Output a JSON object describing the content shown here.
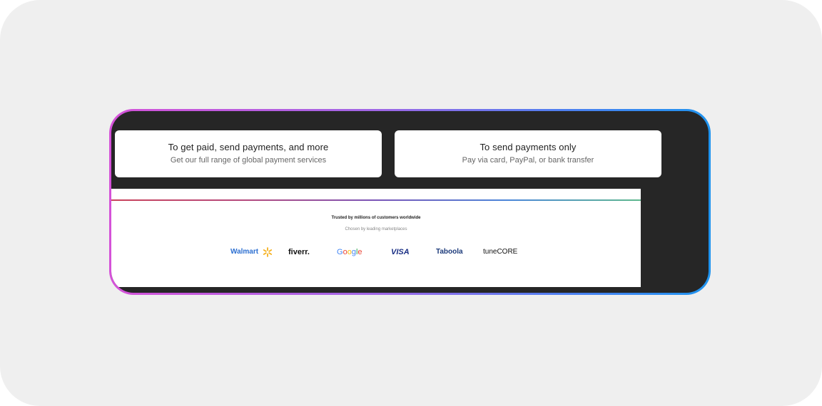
{
  "cards": [
    {
      "title": "To get paid, send payments, and more",
      "subtitle": "Get our full range of global payment services"
    },
    {
      "title": "To send payments only",
      "subtitle": "Pay via card, PayPal, or bank transfer"
    }
  ],
  "trust": {
    "heading": "Trusted by millions of customers worldwide",
    "subheading": "Chosen by leading marketplaces"
  },
  "logos": {
    "walmart": "Walmart",
    "fiverr": "fiverr.",
    "google": [
      "G",
      "o",
      "o",
      "g",
      "l",
      "e"
    ],
    "visa": "VISA",
    "taboola": "Taboola",
    "tunecore": "tuneCORE"
  },
  "colors": {
    "frame_gradient_start": "#d552d8",
    "frame_gradient_end": "#1f94ef",
    "screen_background": "#262626",
    "google_letters": [
      "#4285F4",
      "#EA4335",
      "#FBBC05",
      "#4285F4",
      "#34A853",
      "#EA4335"
    ]
  }
}
